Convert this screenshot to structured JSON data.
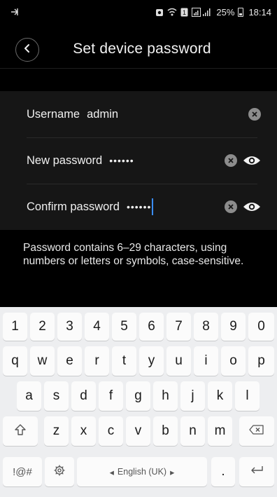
{
  "status_bar": {
    "battery_percent": "25%",
    "time": "18:14"
  },
  "header": {
    "title": "Set device password"
  },
  "form": {
    "username_label": "Username",
    "username_value": "admin",
    "new_password_label": "New password",
    "new_password_value": "••••••",
    "confirm_password_label": "Confirm password",
    "confirm_password_value": "••••••"
  },
  "hint": "Password contains 6–29 characters, using numbers or letters or symbols, case-sensitive.",
  "keyboard": {
    "number_row": [
      "1",
      "2",
      "3",
      "4",
      "5",
      "6",
      "7",
      "8",
      "9",
      "0"
    ],
    "row1": [
      "q",
      "w",
      "e",
      "r",
      "t",
      "y",
      "u",
      "i",
      "o",
      "p"
    ],
    "row2": [
      "a",
      "s",
      "d",
      "f",
      "g",
      "h",
      "j",
      "k",
      "l"
    ],
    "row3": [
      "z",
      "x",
      "c",
      "v",
      "b",
      "n",
      "m"
    ],
    "symbols_label": "!@#",
    "space_label": "English (UK)",
    "period_label": ".",
    "space_left_arrow": "◂",
    "space_right_arrow": "▸"
  },
  "icons": {
    "back": "chevron-left-icon",
    "clear": "clear-icon",
    "show_password": "eye-icon",
    "shift": "shift-icon",
    "backspace": "backspace-icon",
    "settings": "gear-icon",
    "enter": "enter-icon"
  },
  "colors": {
    "background": "#000000",
    "form_background": "#161616",
    "caret": "#3a8dff",
    "keyboard_background": "#edeef0",
    "key_background": "#fbfbfb"
  }
}
